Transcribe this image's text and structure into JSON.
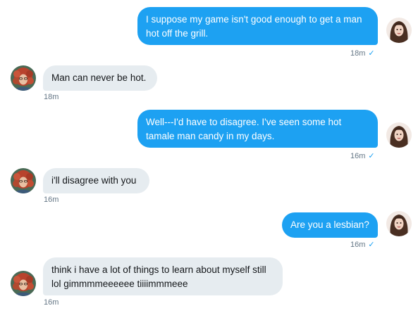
{
  "messages": [
    {
      "direction": "sent",
      "text": "I suppose my game isn't good enough to get a man hot off the grill.",
      "time": "18m",
      "status_icon": "check-icon"
    },
    {
      "direction": "received",
      "text": "Man can never be hot.",
      "time": "18m"
    },
    {
      "direction": "sent",
      "text": "Well---I'd have to disagree. I've seen some hot tamale man candy in my days.",
      "time": "16m",
      "status_icon": "check-icon"
    },
    {
      "direction": "received",
      "text": "i'll disagree with you",
      "time": "16m"
    },
    {
      "direction": "sent",
      "text": "Are you a lesbian?",
      "time": "16m",
      "status_icon": "check-icon"
    },
    {
      "direction": "received",
      "text": "think i have a lot of things to learn about myself still lol gimmmmeeeeee tiiiimmmeee",
      "time": "16m"
    }
  ],
  "colors": {
    "sent_bubble": "#1da1f2",
    "received_bubble": "#e6ecf0",
    "timestamp": "#657786",
    "check": "#1da1f2"
  }
}
